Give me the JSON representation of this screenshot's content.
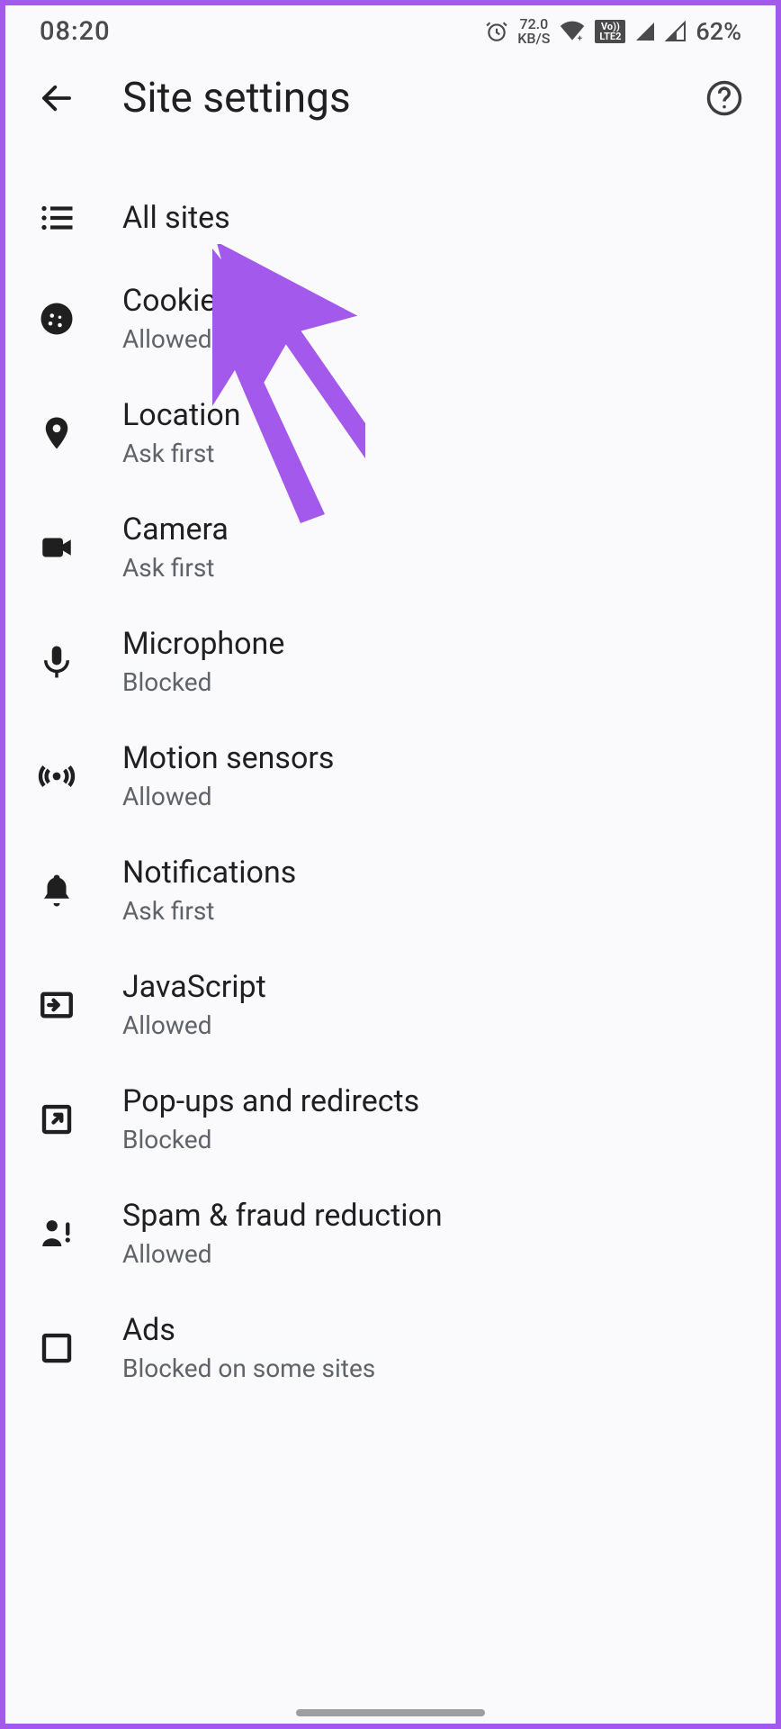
{
  "status": {
    "time": "08:20",
    "speed_top": "72.0",
    "speed_bottom": "KB/S",
    "battery": "62%"
  },
  "appbar": {
    "title": "Site settings"
  },
  "rows": {
    "all_sites": {
      "label": "All sites"
    },
    "cookies": {
      "label": "Cookies",
      "sub": "Allowed"
    },
    "location": {
      "label": "Location",
      "sub": "Ask first"
    },
    "camera": {
      "label": "Camera",
      "sub": "Ask first"
    },
    "microphone": {
      "label": "Microphone",
      "sub": "Blocked"
    },
    "motion": {
      "label": "Motion sensors",
      "sub": "Allowed"
    },
    "notifications": {
      "label": "Notifications",
      "sub": "Ask first"
    },
    "javascript": {
      "label": "JavaScript",
      "sub": "Allowed"
    },
    "popups": {
      "label": "Pop-ups and redirects",
      "sub": "Blocked"
    },
    "spam": {
      "label": "Spam & fraud reduction",
      "sub": "Allowed"
    },
    "ads": {
      "label": "Ads",
      "sub": "Blocked on some sites"
    }
  }
}
